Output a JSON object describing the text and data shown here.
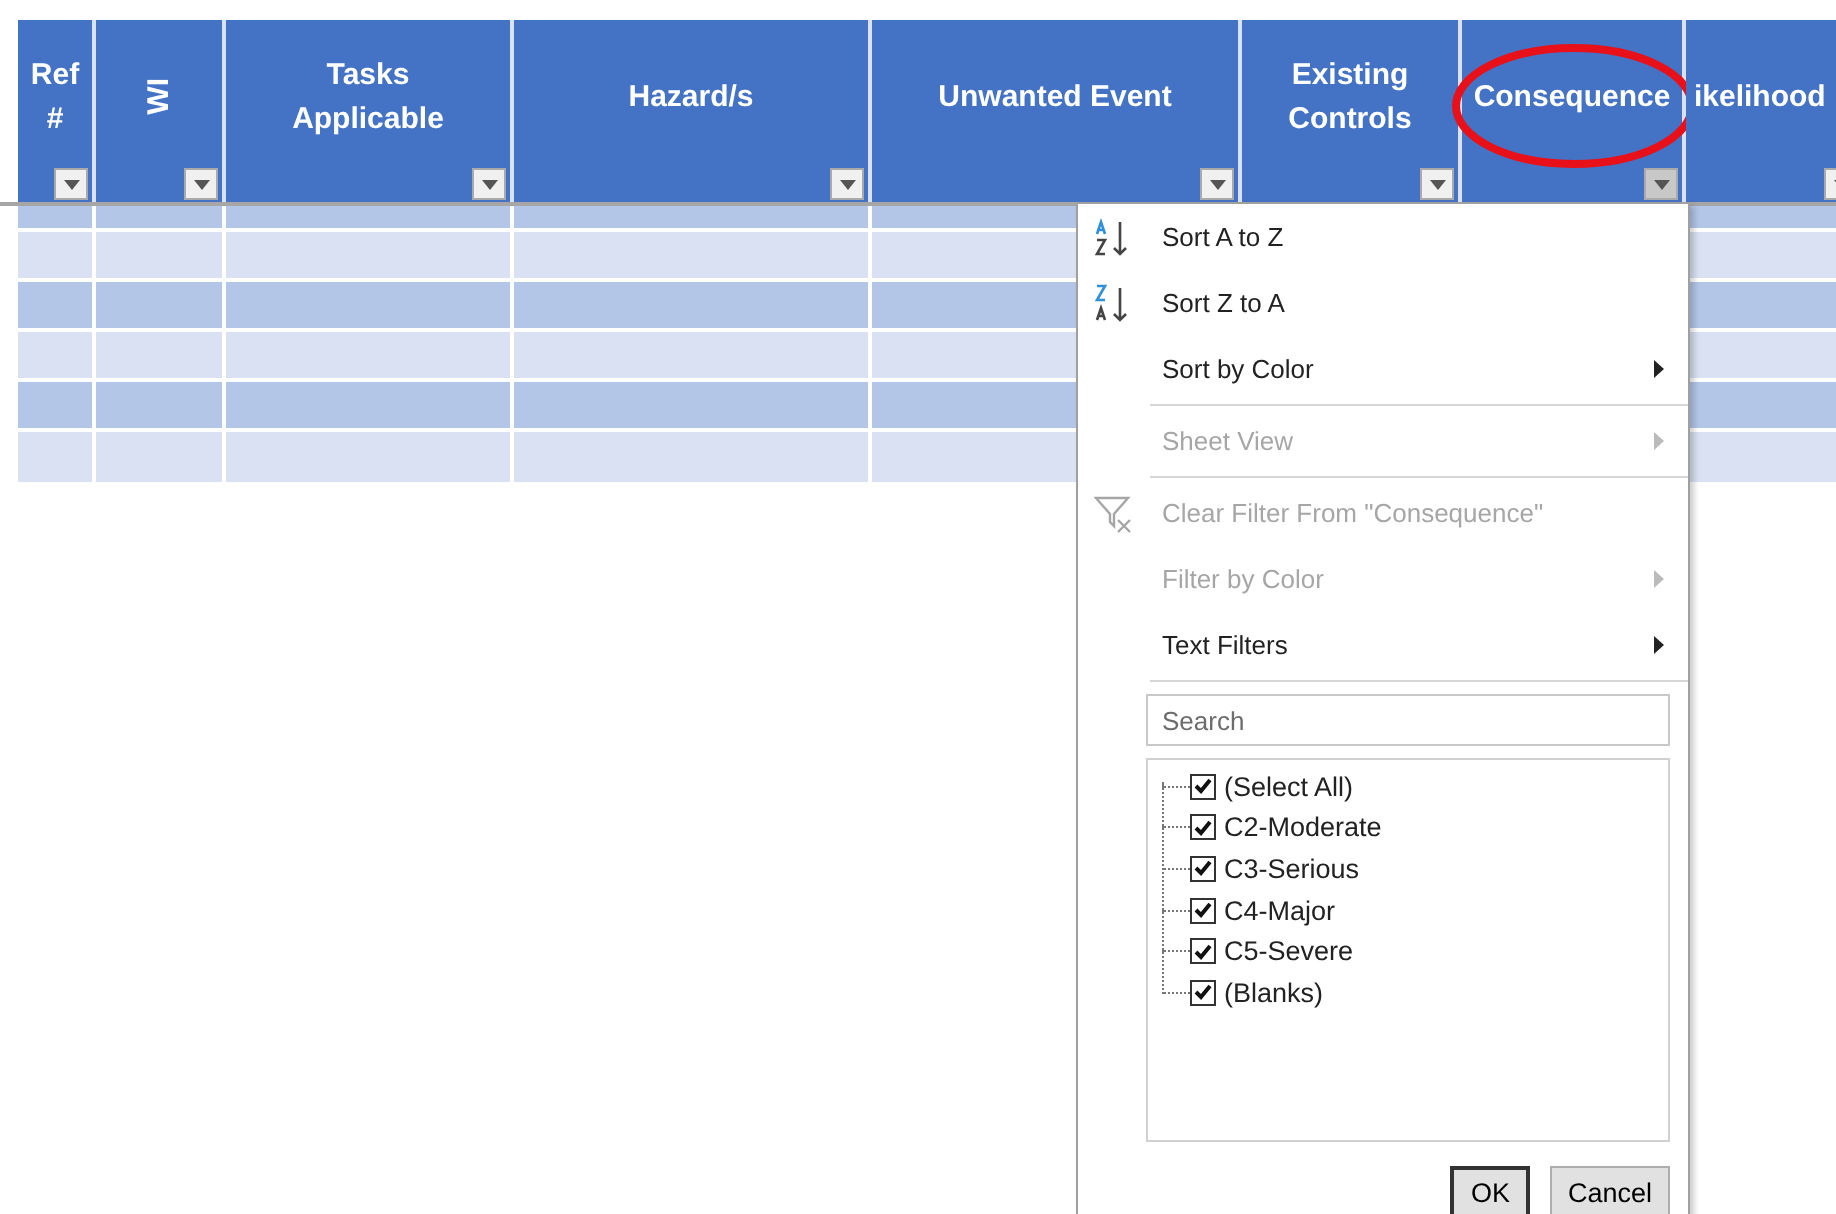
{
  "columns": [
    {
      "label": "Ref #",
      "vertical": false,
      "circled": false,
      "filter_open": false
    },
    {
      "label": "WI",
      "vertical": true,
      "circled": false,
      "filter_open": false
    },
    {
      "label": "Tasks Applicable",
      "vertical": false,
      "circled": false,
      "filter_open": false
    },
    {
      "label": "Hazard/s",
      "vertical": false,
      "circled": false,
      "filter_open": false
    },
    {
      "label": "Unwanted Event",
      "vertical": false,
      "circled": false,
      "filter_open": false
    },
    {
      "label": "Existing Controls",
      "vertical": false,
      "circled": false,
      "filter_open": false
    },
    {
      "label": "Consequence",
      "vertical": false,
      "circled": true,
      "filter_open": true
    },
    {
      "label": "ikelihood",
      "vertical": false,
      "circled": false,
      "filter_open": false
    }
  ],
  "rows": [
    {
      "color": "#b4c6e7"
    },
    {
      "color": "#d9e1f2"
    },
    {
      "color": "#b4c6e7"
    },
    {
      "color": "#d9e1f2"
    },
    {
      "color": "#b4c6e7"
    },
    {
      "color": "#d9e1f2"
    }
  ],
  "filter_menu": {
    "items": [
      {
        "kind": "sort-asc",
        "label": "Sort A to Z",
        "disabled": false,
        "submenu": false
      },
      {
        "kind": "sort-desc",
        "label": "Sort Z to A",
        "disabled": false,
        "submenu": false
      },
      {
        "kind": "plain",
        "label": "Sort by Color",
        "disabled": false,
        "submenu": true
      },
      {
        "kind": "separator"
      },
      {
        "kind": "plain",
        "label": "Sheet View",
        "disabled": true,
        "submenu": true
      },
      {
        "kind": "separator"
      },
      {
        "kind": "clear-filter",
        "label": "Clear Filter From \"Consequence\"",
        "disabled": true,
        "submenu": false
      },
      {
        "kind": "plain",
        "label": "Filter by Color",
        "disabled": true,
        "submenu": true
      },
      {
        "kind": "plain",
        "label": "Text Filters",
        "disabled": false,
        "submenu": true
      },
      {
        "kind": "separator"
      }
    ],
    "search": {
      "placeholder": "Search"
    },
    "values": [
      {
        "label": "(Select All)",
        "checked": true
      },
      {
        "label": "C2-Moderate",
        "checked": true
      },
      {
        "label": "C3-Serious",
        "checked": true
      },
      {
        "label": "C4-Major",
        "checked": true
      },
      {
        "label": "C5-Severe",
        "checked": true
      },
      {
        "label": "(Blanks)",
        "checked": true
      }
    ],
    "buttons": [
      {
        "label": "OK",
        "default": true
      },
      {
        "label": "Cancel",
        "default": false
      }
    ]
  }
}
